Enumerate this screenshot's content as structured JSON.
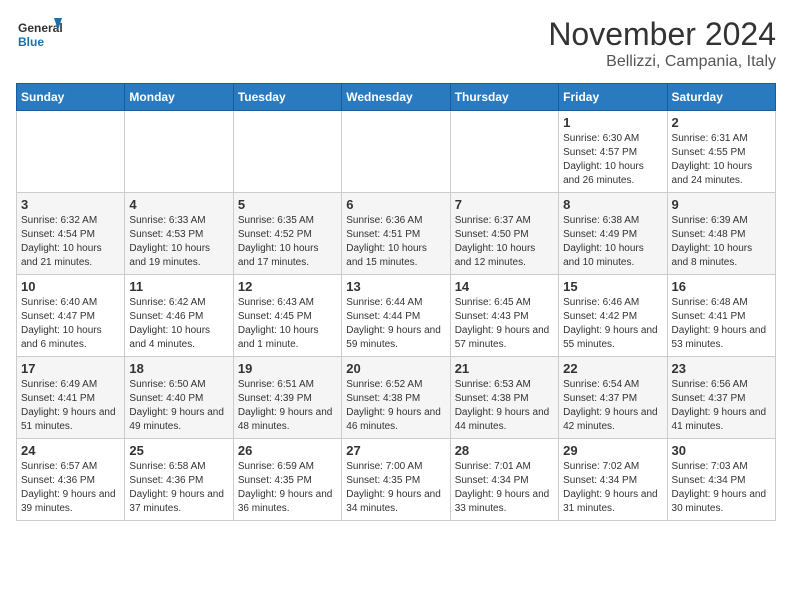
{
  "header": {
    "logo_general": "General",
    "logo_blue": "Blue",
    "month_title": "November 2024",
    "location": "Bellizzi, Campania, Italy"
  },
  "weekdays": [
    "Sunday",
    "Monday",
    "Tuesday",
    "Wednesday",
    "Thursday",
    "Friday",
    "Saturday"
  ],
  "weeks": [
    [
      {
        "day": "",
        "info": ""
      },
      {
        "day": "",
        "info": ""
      },
      {
        "day": "",
        "info": ""
      },
      {
        "day": "",
        "info": ""
      },
      {
        "day": "",
        "info": ""
      },
      {
        "day": "1",
        "info": "Sunrise: 6:30 AM\nSunset: 4:57 PM\nDaylight: 10 hours and 26 minutes."
      },
      {
        "day": "2",
        "info": "Sunrise: 6:31 AM\nSunset: 4:55 PM\nDaylight: 10 hours and 24 minutes."
      }
    ],
    [
      {
        "day": "3",
        "info": "Sunrise: 6:32 AM\nSunset: 4:54 PM\nDaylight: 10 hours and 21 minutes."
      },
      {
        "day": "4",
        "info": "Sunrise: 6:33 AM\nSunset: 4:53 PM\nDaylight: 10 hours and 19 minutes."
      },
      {
        "day": "5",
        "info": "Sunrise: 6:35 AM\nSunset: 4:52 PM\nDaylight: 10 hours and 17 minutes."
      },
      {
        "day": "6",
        "info": "Sunrise: 6:36 AM\nSunset: 4:51 PM\nDaylight: 10 hours and 15 minutes."
      },
      {
        "day": "7",
        "info": "Sunrise: 6:37 AM\nSunset: 4:50 PM\nDaylight: 10 hours and 12 minutes."
      },
      {
        "day": "8",
        "info": "Sunrise: 6:38 AM\nSunset: 4:49 PM\nDaylight: 10 hours and 10 minutes."
      },
      {
        "day": "9",
        "info": "Sunrise: 6:39 AM\nSunset: 4:48 PM\nDaylight: 10 hours and 8 minutes."
      }
    ],
    [
      {
        "day": "10",
        "info": "Sunrise: 6:40 AM\nSunset: 4:47 PM\nDaylight: 10 hours and 6 minutes."
      },
      {
        "day": "11",
        "info": "Sunrise: 6:42 AM\nSunset: 4:46 PM\nDaylight: 10 hours and 4 minutes."
      },
      {
        "day": "12",
        "info": "Sunrise: 6:43 AM\nSunset: 4:45 PM\nDaylight: 10 hours and 1 minute."
      },
      {
        "day": "13",
        "info": "Sunrise: 6:44 AM\nSunset: 4:44 PM\nDaylight: 9 hours and 59 minutes."
      },
      {
        "day": "14",
        "info": "Sunrise: 6:45 AM\nSunset: 4:43 PM\nDaylight: 9 hours and 57 minutes."
      },
      {
        "day": "15",
        "info": "Sunrise: 6:46 AM\nSunset: 4:42 PM\nDaylight: 9 hours and 55 minutes."
      },
      {
        "day": "16",
        "info": "Sunrise: 6:48 AM\nSunset: 4:41 PM\nDaylight: 9 hours and 53 minutes."
      }
    ],
    [
      {
        "day": "17",
        "info": "Sunrise: 6:49 AM\nSunset: 4:41 PM\nDaylight: 9 hours and 51 minutes."
      },
      {
        "day": "18",
        "info": "Sunrise: 6:50 AM\nSunset: 4:40 PM\nDaylight: 9 hours and 49 minutes."
      },
      {
        "day": "19",
        "info": "Sunrise: 6:51 AM\nSunset: 4:39 PM\nDaylight: 9 hours and 48 minutes."
      },
      {
        "day": "20",
        "info": "Sunrise: 6:52 AM\nSunset: 4:38 PM\nDaylight: 9 hours and 46 minutes."
      },
      {
        "day": "21",
        "info": "Sunrise: 6:53 AM\nSunset: 4:38 PM\nDaylight: 9 hours and 44 minutes."
      },
      {
        "day": "22",
        "info": "Sunrise: 6:54 AM\nSunset: 4:37 PM\nDaylight: 9 hours and 42 minutes."
      },
      {
        "day": "23",
        "info": "Sunrise: 6:56 AM\nSunset: 4:37 PM\nDaylight: 9 hours and 41 minutes."
      }
    ],
    [
      {
        "day": "24",
        "info": "Sunrise: 6:57 AM\nSunset: 4:36 PM\nDaylight: 9 hours and 39 minutes."
      },
      {
        "day": "25",
        "info": "Sunrise: 6:58 AM\nSunset: 4:36 PM\nDaylight: 9 hours and 37 minutes."
      },
      {
        "day": "26",
        "info": "Sunrise: 6:59 AM\nSunset: 4:35 PM\nDaylight: 9 hours and 36 minutes."
      },
      {
        "day": "27",
        "info": "Sunrise: 7:00 AM\nSunset: 4:35 PM\nDaylight: 9 hours and 34 minutes."
      },
      {
        "day": "28",
        "info": "Sunrise: 7:01 AM\nSunset: 4:34 PM\nDaylight: 9 hours and 33 minutes."
      },
      {
        "day": "29",
        "info": "Sunrise: 7:02 AM\nSunset: 4:34 PM\nDaylight: 9 hours and 31 minutes."
      },
      {
        "day": "30",
        "info": "Sunrise: 7:03 AM\nSunset: 4:34 PM\nDaylight: 9 hours and 30 minutes."
      }
    ]
  ]
}
